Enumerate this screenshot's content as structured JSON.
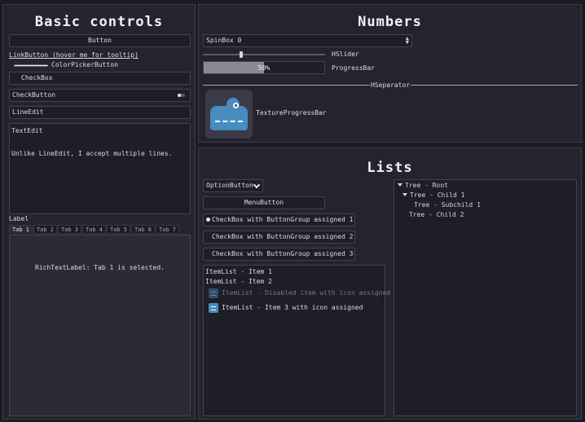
{
  "basic": {
    "title": "Basic controls",
    "button": "Button",
    "link_button": "LinkButton (hover me for tooltip)",
    "color_picker_button": "ColorPickerButton",
    "checkbox": "CheckBox",
    "check_button": "CheckButton",
    "line_edit": "LineEdit",
    "text_edit_line1": "TextEdit",
    "text_edit_line2": "Unlike LineEdit, I accept multiple lines.",
    "label": "Label",
    "tabs": [
      "Tab 1",
      "Tab 2",
      "Tab 3",
      "Tab 4",
      "Tab 5",
      "Tab 6",
      "Tab 7"
    ],
    "rich_text": "RichTextLabel: Tab 1 is selected."
  },
  "numbers": {
    "title": "Numbers",
    "spinbox": "SpinBox 0",
    "hslider_label": "HSlider",
    "slider_value": 0.3,
    "progress_text": "50%",
    "progress_value": 0.5,
    "progress_label": "ProgressBar",
    "hseparator": "HSeparator",
    "texture_progress_label": "TextureProgressBar"
  },
  "lists": {
    "title": "Lists",
    "option_button": "OptionButton",
    "menu_button": "MenuButton",
    "group_checks": [
      "CheckBox with ButtonGroup assigned 1",
      "CheckBox with ButtonGroup assigned 2",
      "CheckBox with ButtonGroup assigned 3"
    ],
    "item_list": {
      "item1": "ItemList - Item 1",
      "item2": "ItemList - Item 2",
      "disabled": "ItemList - Disabled item with icon assigned",
      "item3": "ItemList - Item 3 with icon assigned"
    },
    "tree": {
      "root": "Tree - Root",
      "child1": "Tree - Child 1",
      "subchild1": "Tree - Subchild 1",
      "child2": "Tree - Child 2"
    }
  },
  "colors": {
    "background": "#1c1b24",
    "panel": "#25242e",
    "accent": "#478cbf",
    "progress_fill": "#8a8a96"
  }
}
